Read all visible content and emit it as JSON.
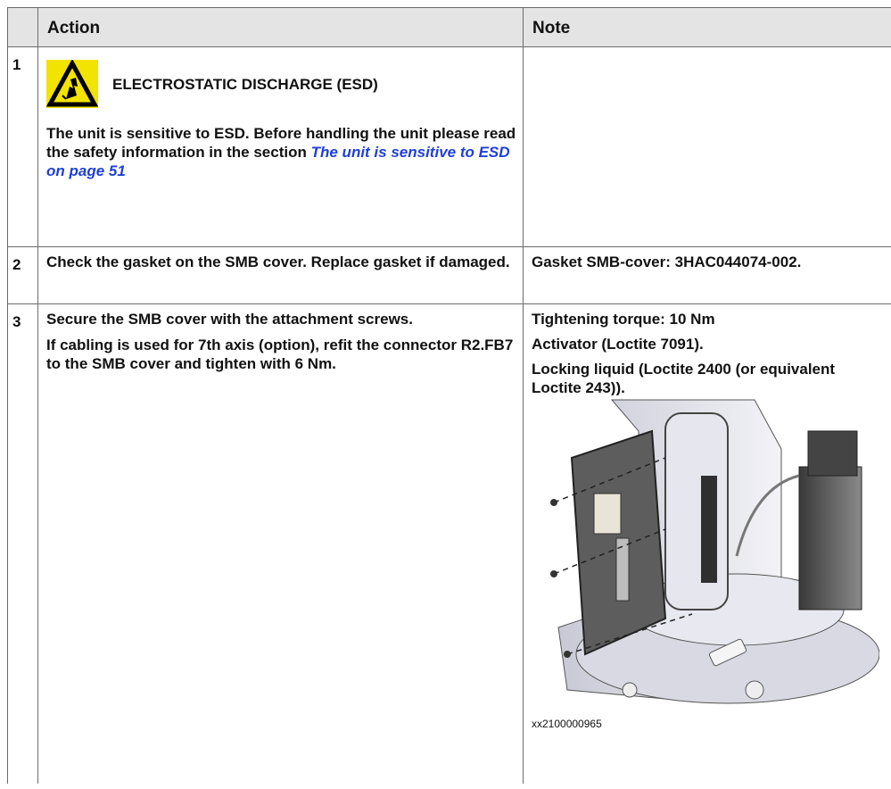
{
  "table": {
    "headers": {
      "col_num": "",
      "col_action": "Action",
      "col_note": "Note"
    },
    "rows": [
      {
        "num": "1",
        "esd_title": "ELECTROSTATIC DISCHARGE (ESD)",
        "action_text": "The unit is sensitive to ESD. Before handling the unit please read the safety information in the section ",
        "action_link": "The unit is sensitive to ESD on page 51",
        "note": ""
      },
      {
        "num": "2",
        "action": "Check the gasket on the SMB cover. Replace gasket if damaged.",
        "note": "Gasket SMB-cover: 3HAC044074-002."
      },
      {
        "num": "3",
        "action_p1": "Secure the SMB cover with the attachment screws.",
        "action_p2": "If cabling is used for 7th axis (option), refit the connector R2.FB7 to the SMB cover and tighten with 6 Nm.",
        "note_p1": "Tightening torque: 10 Nm",
        "note_p2": "Activator (Loctite 7091).",
        "note_p3": "Locking liquid (Loctite 2400 (or equivalent Loctite 243)).",
        "figure_caption": "xx2100000965"
      }
    ]
  },
  "icons": {
    "esd": "esd-warning-icon"
  },
  "colors": {
    "link": "#1f3fd6",
    "header_bg": "#e4e4e4",
    "esd_yellow": "#f2e300"
  }
}
